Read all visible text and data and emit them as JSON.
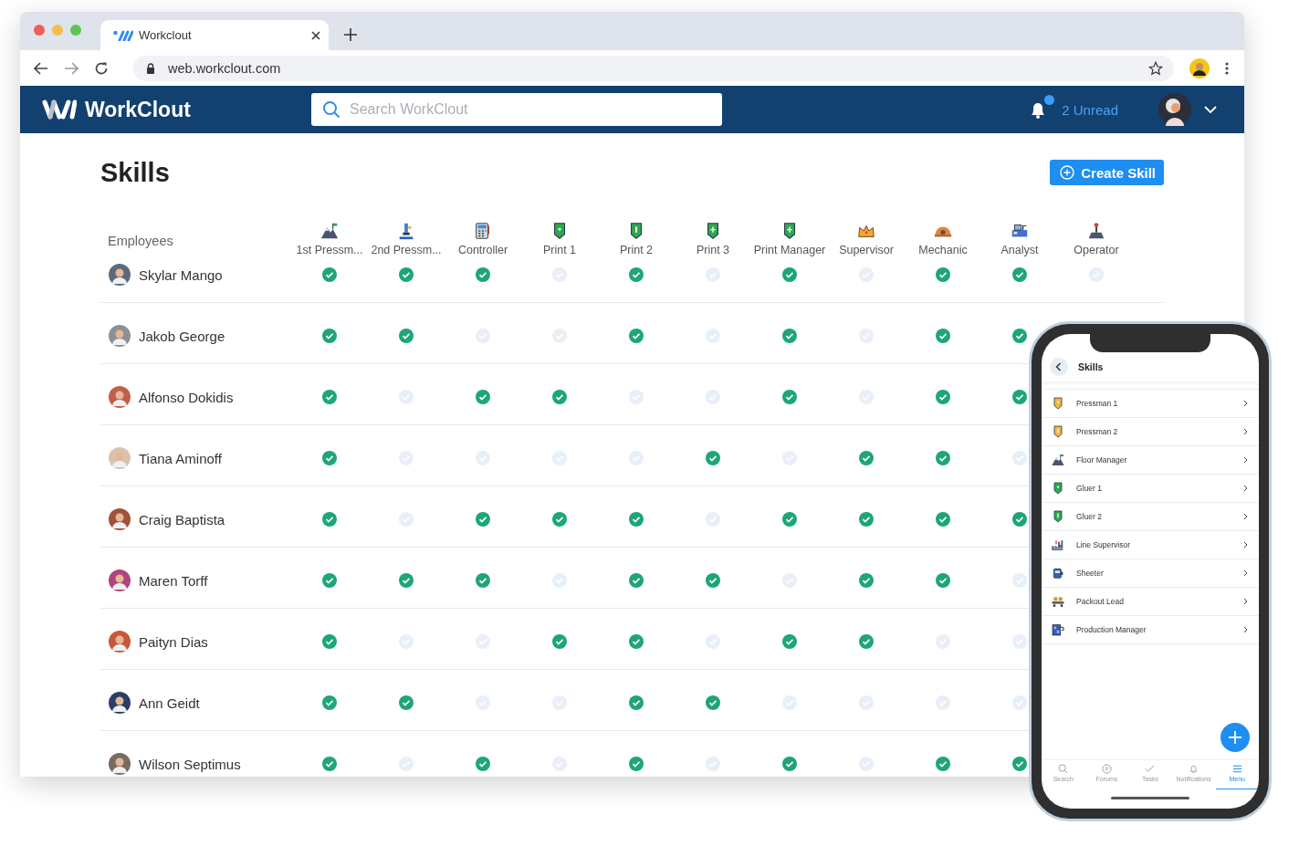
{
  "browser": {
    "tab_title": "Workclout",
    "url": "web.workclout.com"
  },
  "app_header": {
    "brand": "WorkClout",
    "search": {
      "placeholder": "Search WorkClout"
    },
    "notifications": {
      "unread": true,
      "label": "2 Unread"
    }
  },
  "page": {
    "title": "Skills",
    "create_button": "Create Skill"
  },
  "skills_table": {
    "employees_heading": "Employees",
    "columns": [
      "1st Pressm...",
      "2nd Pressm...",
      "Controller",
      "Print 1",
      "Print 2",
      "Print 3",
      "Print Manager",
      "Supervisor",
      "Mechanic",
      "Analyst",
      "Operator"
    ],
    "rows": [
      {
        "name": "Skylar Mango",
        "skills": [
          true,
          true,
          true,
          false,
          true,
          false,
          true,
          false,
          true,
          true,
          false
        ]
      },
      {
        "name": "Jakob George",
        "skills": [
          true,
          true,
          false,
          false,
          true,
          false,
          true,
          false,
          true,
          true
        ]
      },
      {
        "name": "Alfonso Dokidis",
        "skills": [
          true,
          false,
          true,
          true,
          false,
          false,
          true,
          false,
          true,
          true
        ]
      },
      {
        "name": "Tiana Aminoff",
        "skills": [
          true,
          false,
          false,
          false,
          false,
          true,
          false,
          true,
          true,
          false
        ]
      },
      {
        "name": "Craig Baptista",
        "skills": [
          true,
          false,
          true,
          true,
          true,
          false,
          true,
          true,
          true,
          true
        ]
      },
      {
        "name": "Maren Torff",
        "skills": [
          true,
          true,
          true,
          false,
          true,
          true,
          false,
          true,
          true,
          false
        ]
      },
      {
        "name": "Paityn Dias",
        "skills": [
          true,
          false,
          false,
          true,
          true,
          false,
          true,
          true,
          false,
          false
        ]
      },
      {
        "name": "Ann Geidt",
        "skills": [
          true,
          true,
          false,
          false,
          true,
          true,
          false,
          false,
          false,
          false
        ]
      },
      {
        "name": "Wilson Septimus",
        "skills": [
          true,
          false,
          true,
          false,
          true,
          false,
          true,
          false,
          true,
          true
        ]
      }
    ]
  },
  "phone": {
    "title": "Skills",
    "skills": [
      "Pressman 1",
      "Pressman 2",
      "Floor Manager",
      "Gluer 1",
      "Gluer 2",
      "Line Supervisor",
      "Sheeter",
      "Packout Lead",
      "Production Manager"
    ],
    "nav": [
      {
        "label": "Search",
        "selected": false
      },
      {
        "label": "Forums",
        "selected": false
      },
      {
        "label": "Tasks",
        "selected": false
      },
      {
        "label": "Notifications",
        "selected": false
      },
      {
        "label": "Menu",
        "selected": true
      }
    ]
  }
}
